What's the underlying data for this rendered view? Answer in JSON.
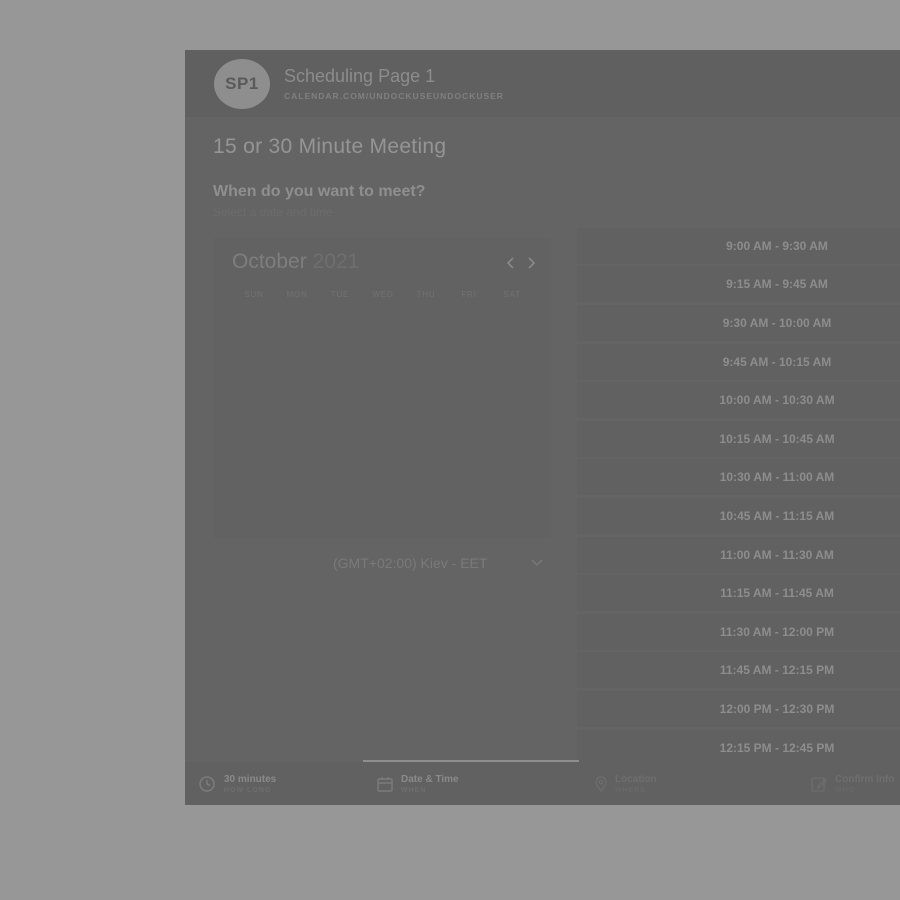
{
  "header": {
    "avatar_initials": "SP1",
    "page_name": "Scheduling Page 1",
    "page_url": "CALENDAR.COM/UNDOCKUSEUNDOCKUSER"
  },
  "meeting": {
    "title": "15 or 30 Minute Meeting",
    "question": "When do you want to meet?",
    "subquestion": "Select a date and time"
  },
  "calendar": {
    "month": "October",
    "year": "2021",
    "prev_icon": "chevron-left-icon",
    "next_icon": "chevron-right-icon",
    "weekdays": [
      "SUN",
      "MON",
      "TUE",
      "WED",
      "THU",
      "FRI",
      "SAT"
    ]
  },
  "timezone": {
    "selected": "(GMT+02:00) Kiev - EET",
    "icon": "chevron-down-icon"
  },
  "time_slots": [
    "9:00 AM - 9:30 AM",
    "9:15 AM - 9:45 AM",
    "9:30 AM - 10:00 AM",
    "9:45 AM - 10:15 AM",
    "10:00 AM - 10:30 AM",
    "10:15 AM - 10:45 AM",
    "10:30 AM - 11:00 AM",
    "10:45 AM - 11:15 AM",
    "11:00 AM - 11:30 AM",
    "11:15 AM - 11:45 AM",
    "11:30 AM - 12:00 PM",
    "11:45 AM - 12:15 PM",
    "12:00 PM - 12:30 PM",
    "12:15 PM - 12:45 PM"
  ],
  "footer_steps": [
    {
      "icon": "clock-icon",
      "title": "30 minutes",
      "subtitle": "HOW LONG",
      "active": false
    },
    {
      "icon": "calendar-icon",
      "title": "Date & Time",
      "subtitle": "WHEN",
      "active": true
    },
    {
      "icon": "location-pin-icon",
      "title": "Location",
      "subtitle": "WHERE",
      "active": false
    },
    {
      "icon": "edit-form-icon",
      "title": "Confirm Info",
      "subtitle": "WHO",
      "active": false
    }
  ],
  "colors": {
    "backdrop": "#979797",
    "card": "#646464",
    "slot_bg": "#616161",
    "active_step_indicator": "#8e8e8e"
  }
}
